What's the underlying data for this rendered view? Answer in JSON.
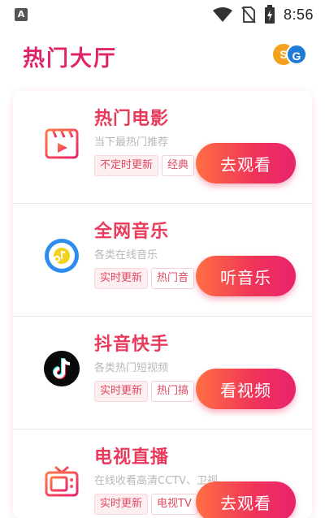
{
  "status_bar": {
    "left_icon_glyph": "A",
    "time": "8:56",
    "icons": [
      "wifi-icon",
      "no-sim-icon",
      "battery-charging-icon"
    ]
  },
  "header": {
    "title": "热门大厅",
    "logo": {
      "left": "S",
      "right": "G"
    }
  },
  "colors": {
    "accent": "#e0246a",
    "title_red": "#ea3a5c",
    "button_start": "#ff6f43",
    "button_end": "#e8246c"
  },
  "items": [
    {
      "title": "热门电影",
      "desc": "当下最热门推荐",
      "tags": [
        "不定时更新",
        "经典"
      ],
      "button": "去观看",
      "icon": "film-clapper-icon"
    },
    {
      "title": "全网音乐",
      "desc": "各类在线音乐",
      "tags": [
        "实时更新",
        "热门音"
      ],
      "button": "听音乐",
      "icon": "music-disc-icon"
    },
    {
      "title": "抖音快手",
      "desc": "各类热门短视频",
      "tags": [
        "实时更新",
        "热门搞"
      ],
      "button": "看视频",
      "icon": "tiktok-icon"
    },
    {
      "title": "电视直播",
      "desc": "在线收看高清CCTV、卫视",
      "tags": [
        "实时更新",
        "电视TV"
      ],
      "button": "去观看",
      "icon": "tv-icon"
    }
  ]
}
